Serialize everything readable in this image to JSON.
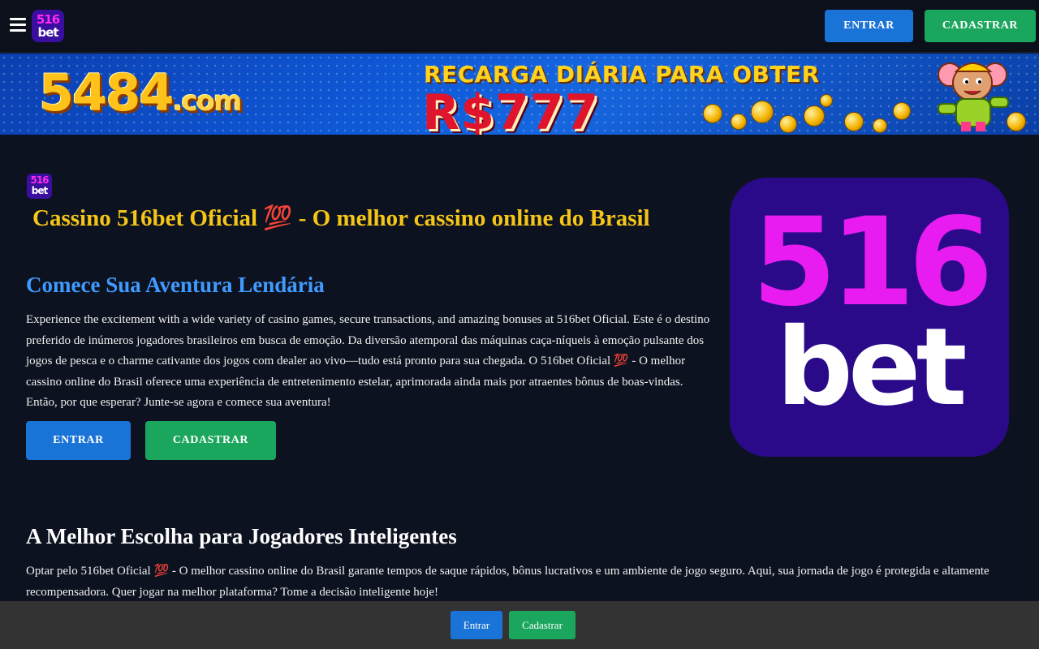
{
  "header": {
    "logo_top": "516",
    "logo_bottom": "bet",
    "login_label": "ENTRAR",
    "register_label": "CADASTRAR"
  },
  "banner": {
    "domain_main": "5484",
    "domain_suffix": ".com",
    "headline": "RECARGA DIÁRIA PARA OBTER",
    "amount": "R$777"
  },
  "hero": {
    "small_logo_top": "516",
    "small_logo_bottom": "bet",
    "title": "Cassino 516bet Oficial 💯 - O melhor cassino online do Brasil",
    "subtitle": "Comece Sua Aventura Lendária",
    "paragraph": "Experience the excitement with a wide variety of casino games, secure transactions, and amazing bonuses at 516bet Oficial. Este é o destino preferido de inúmeros jogadores brasileiros em busca de emoção. Da diversão atemporal das máquinas caça-níqueis à emoção pulsante dos jogos de pesca e o charme cativante dos jogos com dealer ao vivo—tudo está pronto para sua chegada. O 516bet Oficial 💯 - O melhor cassino online do Brasil oferece uma experiência de entretenimento estelar, aprimorada ainda mais por atraentes bônus de boas-vindas. Então, por que esperar? Junte-se agora e comece sua aventura!",
    "login_label": "ENTRAR",
    "register_label": "CADASTRAR",
    "big_logo_top": "516",
    "big_logo_bottom": "bet"
  },
  "section2": {
    "heading": "A Melhor Escolha para Jogadores Inteligentes",
    "paragraph": "Optar pelo 516bet Oficial 💯 - O melhor cassino online do Brasil garante tempos de saque rápidos, bônus lucrativos e um ambiente de jogo seguro. Aqui, sua jornada de jogo é protegida e altamente recompensadora. Quer jogar na melhor plataforma? Tome a decisão inteligente hoje!"
  },
  "bottom_bar": {
    "login_label": "Entrar",
    "register_label": "Cadastrar"
  },
  "colors": {
    "background": "#0d1220",
    "login_button": "#1a73d6",
    "register_button": "#1aa65c",
    "title": "#f5c518",
    "subtitle": "#3f9bff",
    "brand_purple": "#2a0a88",
    "brand_magenta": "#e81cf0"
  },
  "icons": {
    "menu": "hamburger-menu-icon"
  }
}
